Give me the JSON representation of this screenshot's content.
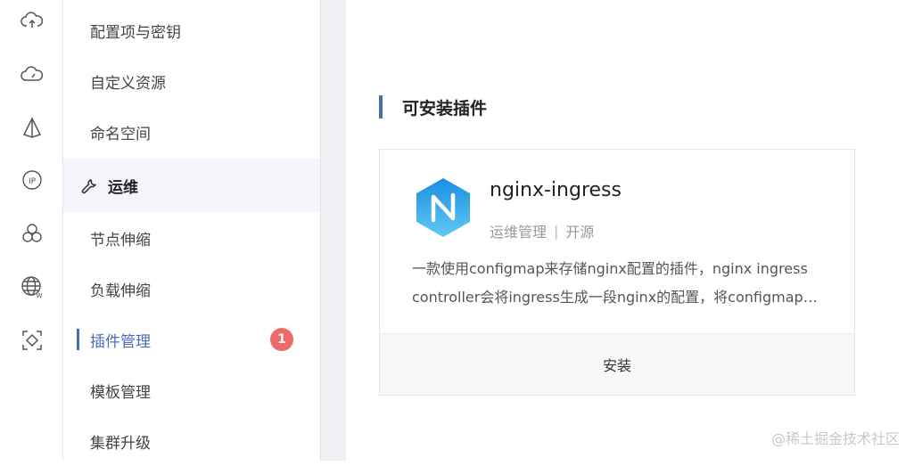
{
  "rail": {
    "icons": [
      "cloud-upload-icon",
      "cloud-speed-icon",
      "pyramid-icon",
      "ip-icon",
      "cluster-icon",
      "globe-w-icon",
      "scan-diamond-icon"
    ]
  },
  "sidebar": {
    "items": [
      {
        "label": "配置项与密钥"
      },
      {
        "label": "自定义资源"
      },
      {
        "label": "命名空间"
      }
    ],
    "section": {
      "label": "运维",
      "icon": "wrench-icon"
    },
    "sub_items": [
      {
        "label": "节点伸缩"
      },
      {
        "label": "负载伸缩"
      },
      {
        "label": "插件管理",
        "badge": "1"
      },
      {
        "label": "模板管理"
      },
      {
        "label": "集群升级"
      }
    ]
  },
  "main": {
    "section_title": "可安装插件",
    "plugin": {
      "name": "nginx-ingress",
      "tag1": "运维管理",
      "tag_sep": "|",
      "tag2": "开源",
      "description": "一款使用configmap来存储nginx配置的插件，nginx ingress controller会将ingress生成一段nginx的配置，将configmap中的配置加载到nginx中",
      "install_label": "安装"
    }
  },
  "watermark": "@稀土掘金技术社区",
  "colors": {
    "accent": "#4a6bb8",
    "badge": "#f06a6a",
    "logo_top": "#1a8fe0",
    "logo_bottom": "#62c9f5"
  }
}
